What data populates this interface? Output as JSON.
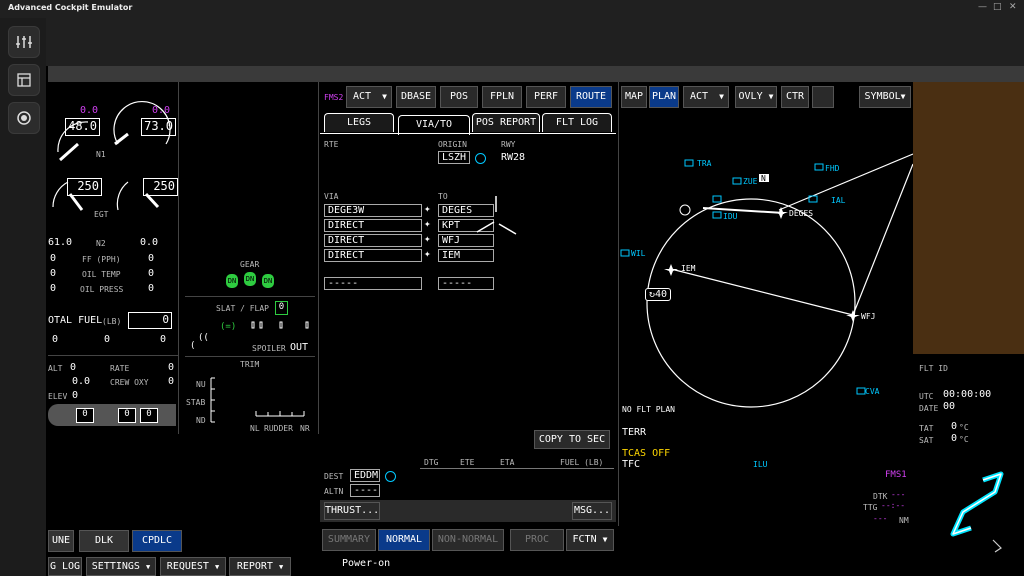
{
  "app_title": "Advanced Cockpit Emulator",
  "window_controls": {
    "minimize": "—",
    "maximize": "□",
    "close": "✕"
  },
  "sidebar": {
    "items": [
      {
        "icon": "sliders-icon"
      },
      {
        "icon": "layout-icon"
      },
      {
        "icon": "record-icon"
      }
    ]
  },
  "eicas": {
    "n1_left": "48.0",
    "n1_right": "73.0",
    "n1_left_cmd": "0.0",
    "n1_right_cmd": "0.0",
    "n1_label": "N1",
    "egt_left": "250",
    "egt_right": "250",
    "egt_label": "EGT",
    "n2_label": "N2",
    "n2_left": "61.0",
    "n2_right": "0.0",
    "ff_label": "FF (PPH)",
    "ff_left": "0",
    "ff_right": "0",
    "oil_temp_label": "OIL TEMP",
    "oil_temp_left": "0",
    "oil_temp_right": "0",
    "oil_press_label": "OIL PRESS",
    "oil_press_left": "0",
    "oil_press_right": "0",
    "total_fuel_label": "OTAL FUEL",
    "total_fuel_unit": "(LB)",
    "total_fuel_value": "0",
    "fuel_tanks": [
      "0",
      "0",
      "0"
    ],
    "alt_label": "ALT",
    "alt_value": "0",
    "rate_label": "RATE",
    "rate_value": "0",
    "crew_oxy_label": "CREW OXY",
    "crew_oxy_value": "0",
    "cab_value": "0.0",
    "elev_label": "ELEV",
    "elev_value": "0",
    "bottom_boxes": [
      "0",
      "0",
      "0"
    ]
  },
  "gear_panel": {
    "gear_label": "GEAR",
    "gear_states": [
      "DN",
      "DN",
      "DN"
    ],
    "slat_flap_label": "SLAT / FLAP",
    "slat_flap_value": "0",
    "spoiler_label": "SPOILER",
    "spoiler_value": "OUT",
    "trim_label": "TRIM",
    "trim_nu": "NU",
    "trim_stab": "STAB",
    "trim_nd": "ND",
    "rudder_nl": "NL",
    "rudder_label": "RUDDER",
    "rudder_nr": "NR"
  },
  "fms": {
    "source": "FMS2",
    "mode": "ACT",
    "menu": [
      "DBASE",
      "POS",
      "FPLN",
      "PERF",
      "ROUTE"
    ],
    "active_menu": "ROUTE",
    "tabs": [
      "LEGS",
      "VIA/TO",
      "POS REPORT",
      "FLT LOG"
    ],
    "active_tab": "VIA/TO",
    "rte_label": "RTE",
    "origin_label": "ORIGIN",
    "origin": "LSZH",
    "rwy_label": "RWY",
    "rwy": "RW28",
    "via_label": "VIA",
    "to_label": "TO",
    "rows": [
      {
        "via": "DEGE3W",
        "to": "DEGES"
      },
      {
        "via": "DIRECT",
        "to": "KPT"
      },
      {
        "via": "DIRECT",
        "to": "WFJ"
      },
      {
        "via": "DIRECT",
        "to": "IEM"
      }
    ],
    "empty_via": "-----",
    "empty_to": "-----",
    "copy_button": "COPY TO SEC",
    "dtg": "DTG",
    "ete": "ETE",
    "eta": "ETA",
    "fuel": "FUEL (LB)",
    "dest_label": "DEST",
    "dest": "EDDM",
    "altn_label": "ALTN",
    "altn": "----",
    "thrust_button": "THRUST...",
    "msg_button": "MSG..."
  },
  "nav": {
    "buttons": {
      "map": "MAP",
      "plan": "PLAN",
      "mode": "ACT",
      "ovly": "OVLY",
      "ctr": "CTR",
      "symbol": "SYMBOL"
    },
    "range": "40",
    "status_lines": [
      "NO FLT PLAN",
      "TERR"
    ],
    "tcas": "TCAS OFF",
    "tfc": "TFC",
    "waypoints": [
      {
        "id": "TRA"
      },
      {
        "id": "FHD"
      },
      {
        "id": "ZUE"
      },
      {
        "id": "IAL"
      },
      {
        "id": "IDU"
      },
      {
        "id": "DEGES"
      },
      {
        "id": "WIL"
      },
      {
        "id": "IEM"
      },
      {
        "id": "WFJ"
      },
      {
        "id": "CVA"
      },
      {
        "id": "ILU"
      },
      {
        "id": "N"
      }
    ],
    "fms_label": "FMS1",
    "dtk": "DTK",
    "ttg": "TTG",
    "nm": "NM",
    "dashes": "---",
    "ttg_val": "--:--"
  },
  "flight_info": {
    "flt_id_label": "FLT ID",
    "utc_label": "UTC",
    "utc_value": "00:00:00",
    "date_label": "DATE",
    "date_value": "00",
    "tat_label": "TAT",
    "tat_value": "0",
    "sat_label": "SAT",
    "sat_value": "0",
    "temp_unit": "°C"
  },
  "bottom_left": {
    "tabs": [
      "UNE",
      "DLK",
      "CPDLC"
    ],
    "active": "CPDLC",
    "menu": [
      "G LOG",
      "SETTINGS",
      "REQUEST",
      "REPORT"
    ]
  },
  "checklist": {
    "tabs": [
      "SUMMARY",
      "NORMAL",
      "NON-NORMAL",
      "PROC",
      "FCTN"
    ],
    "active": "NORMAL",
    "item": "Power-on"
  },
  "colors": {
    "accent_blue": "#0a3a8a",
    "cyan": "#00c8ff",
    "magenta": "#d040f0",
    "green": "#2ecc40",
    "yellow": "#ffd700",
    "brown": "#5a3a1a"
  }
}
